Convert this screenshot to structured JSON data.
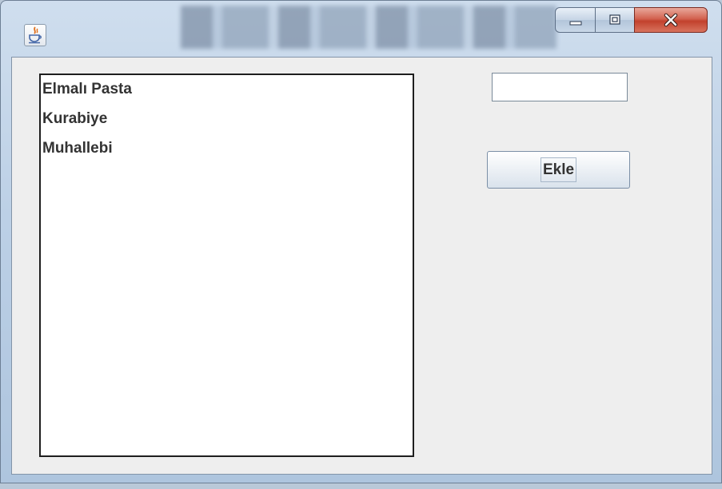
{
  "window": {
    "title": "",
    "controls": {
      "minimize": "minimize-icon",
      "maximize": "maximize-icon",
      "close": "close-icon"
    }
  },
  "list": {
    "items": [
      "Elmalı Pasta",
      "Kurabiye",
      "Muhallebi"
    ]
  },
  "input": {
    "value": ""
  },
  "add_button": {
    "label": "Ekle"
  },
  "colors": {
    "close_button": "#c9452f",
    "client_background": "#eeeeee",
    "list_border": "#1e1e1e",
    "text": "#333333"
  }
}
